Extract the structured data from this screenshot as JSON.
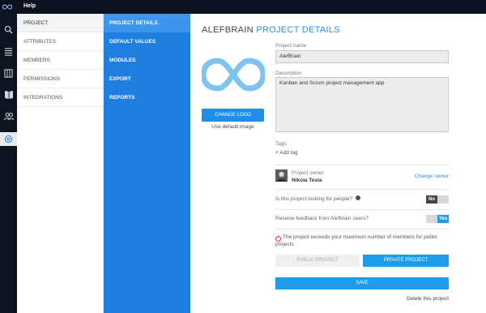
{
  "topbar": {
    "help_label": "Help"
  },
  "rail": {
    "icons": [
      "search-icon",
      "list-icon",
      "map-icon",
      "book-icon",
      "team-icon",
      "settings-icon"
    ]
  },
  "menu_primary": {
    "items": [
      {
        "label": "PROJECT",
        "active": true
      },
      {
        "label": "ATTRIBUTES",
        "active": false
      },
      {
        "label": "MEMBERS",
        "active": false
      },
      {
        "label": "PERMISSIONS",
        "active": false
      },
      {
        "label": "INTEGRATIONS",
        "active": false
      }
    ]
  },
  "menu_secondary": {
    "items": [
      {
        "label": "PROJECT DETAILS",
        "active": true
      },
      {
        "label": "DEFAULT VALUES",
        "active": false
      },
      {
        "label": "MODULES",
        "active": false
      },
      {
        "label": "EXPORT",
        "active": false
      },
      {
        "label": "REPORTS",
        "active": false
      }
    ]
  },
  "main": {
    "title_project": "ALEFBRAIN",
    "title_section": "PROJECT DETAILS",
    "change_logo_label": "CHANGE LOGO",
    "use_default_label": "Use default image",
    "project_name_label": "Project name",
    "project_name_value": "AlefBrain",
    "description_label": "Description",
    "description_value": "Kanban and Scrum project management app",
    "tags_label": "Tags",
    "add_tag_label": "+ Add tag",
    "owner_label": "Project owner",
    "owner_name": "Nikola Tesla",
    "change_owner_label": "Change owner",
    "looking_question": "Is this project looking for people?",
    "looking_value": "No",
    "feedback_question": "Receive feedback from Alefbrain users?",
    "feedback_value": "Yes",
    "warning_text": "The project exceeds your maximum number of members for public projects",
    "public_label": "PUBLIC PROJECT",
    "private_label": "PRIVATE PROJECT",
    "save_label": "SAVE",
    "delete_label": "Delete this project"
  },
  "colors": {
    "accent": "#1e9be9",
    "menu_blue": "#1f7fe0",
    "rail_dark": "#0c1422"
  }
}
